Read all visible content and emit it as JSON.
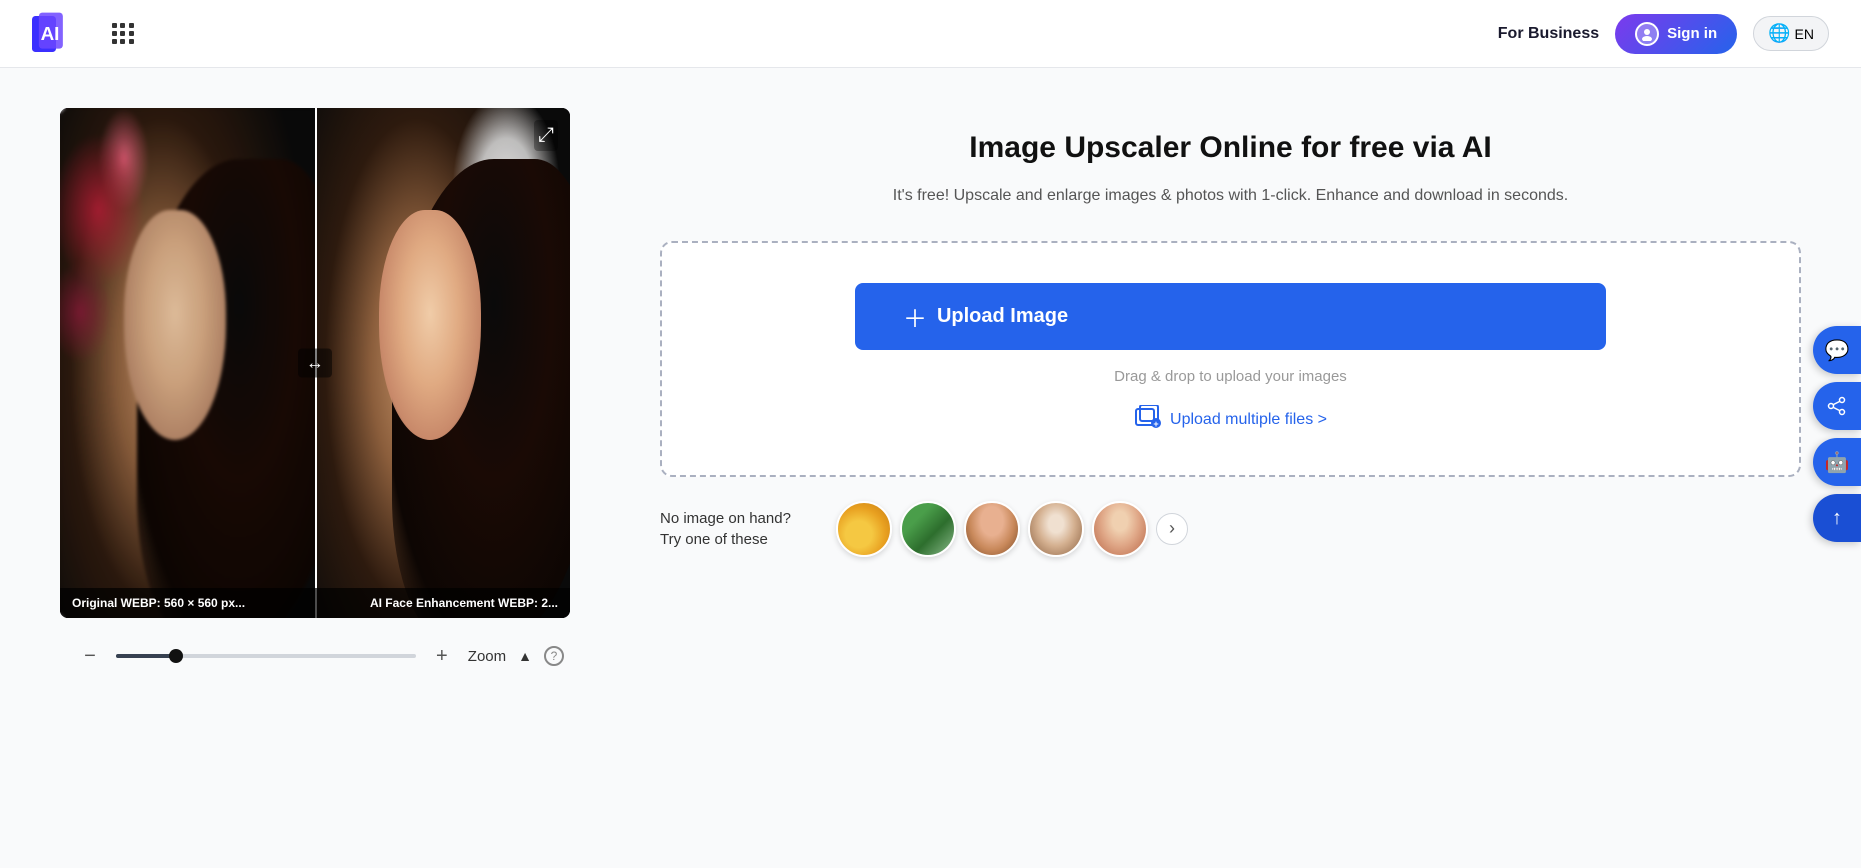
{
  "header": {
    "logo_text": "AI",
    "grid_icon_label": "menu",
    "for_business_label": "For Business",
    "sign_in_label": "Sign in",
    "lang_label": "EN"
  },
  "hero": {
    "title": "Image Upscaler Online for free via AI",
    "subtitle": "It's free! Upscale and enlarge images & photos with 1-click. Enhance and download in seconds."
  },
  "upload": {
    "button_label": "Upload Image",
    "drag_drop_text": "Drag & drop to upload your images",
    "upload_multiple_label": "Upload multiple files >"
  },
  "samples": {
    "label": "No image on hand?\nTry one of these",
    "thumbs": [
      {
        "name": "car",
        "alt": "Yellow car"
      },
      {
        "name": "road",
        "alt": "Road scene"
      },
      {
        "name": "woman1",
        "alt": "Woman portrait"
      },
      {
        "name": "family",
        "alt": "Family photo"
      },
      {
        "name": "woman2",
        "alt": "Woman smiling"
      }
    ],
    "arrow_label": "›"
  },
  "image_compare": {
    "left_label": "Original WEBP: 560 × 560 px...",
    "right_label": "AI Face Enhancement WEBP: 2...",
    "divider_arrows": "↔",
    "expand_icon": "⤢"
  },
  "zoom": {
    "minus_label": "−",
    "plus_label": "+",
    "label": "Zoom",
    "up_icon": "▲",
    "help_icon": "?"
  },
  "floating_buttons": [
    {
      "icon": "💬",
      "name": "chat"
    },
    {
      "icon": "↗",
      "name": "share"
    },
    {
      "icon": "🤖",
      "name": "ai-assistant"
    },
    {
      "icon": "↑",
      "name": "scroll-top"
    }
  ]
}
